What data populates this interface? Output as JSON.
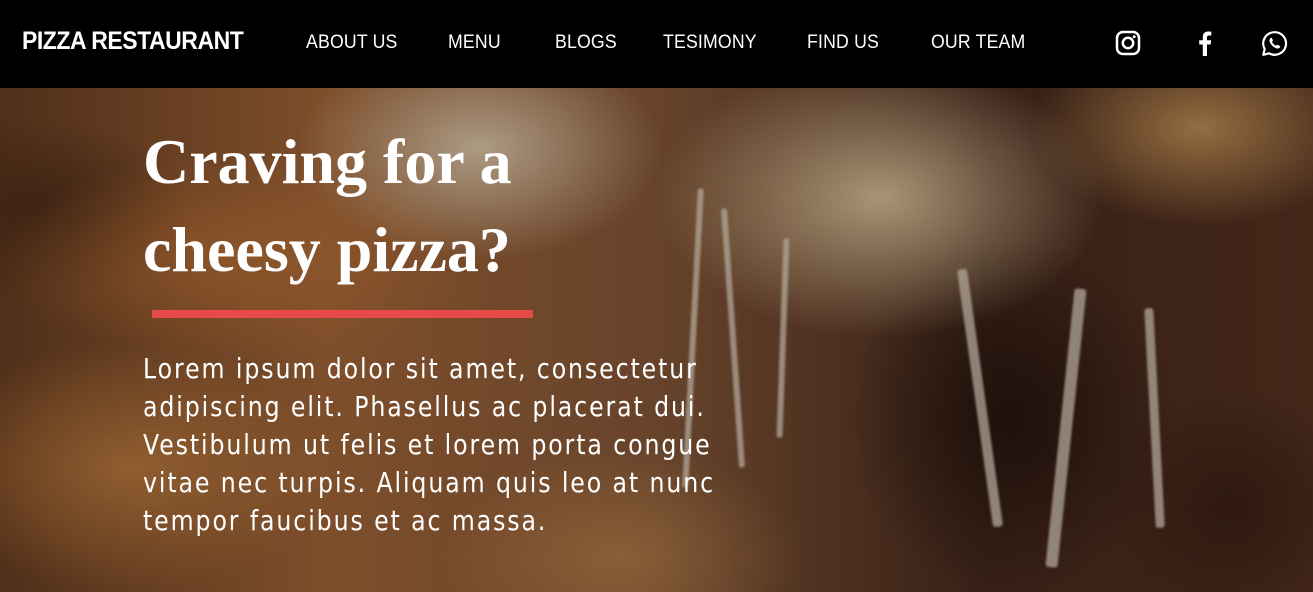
{
  "brand": "PIZZA RESTAURANT",
  "nav": {
    "items": [
      {
        "label": "ABOUT US"
      },
      {
        "label": "MENU"
      },
      {
        "label": "BLOGS"
      },
      {
        "label": "TESIMONY"
      },
      {
        "label": "FIND US"
      },
      {
        "label": "OUR TEAM"
      }
    ],
    "social": [
      "instagram-icon",
      "facebook-icon",
      "whatsapp-icon"
    ]
  },
  "hero": {
    "title": "Craving for a cheesy pizza?",
    "text": "Lorem ipsum dolor sit amet, consectetur adipiscing elit. Phasellus ac placerat dui. Vestibulum ut felis et lorem porta congue vitae nec turpis. Aliquam quis leo at nunc tempor faucibus et ac massa.",
    "divider_color": "#e84a4a"
  },
  "colors": {
    "navbar": "#000000",
    "text": "#ffffff"
  }
}
